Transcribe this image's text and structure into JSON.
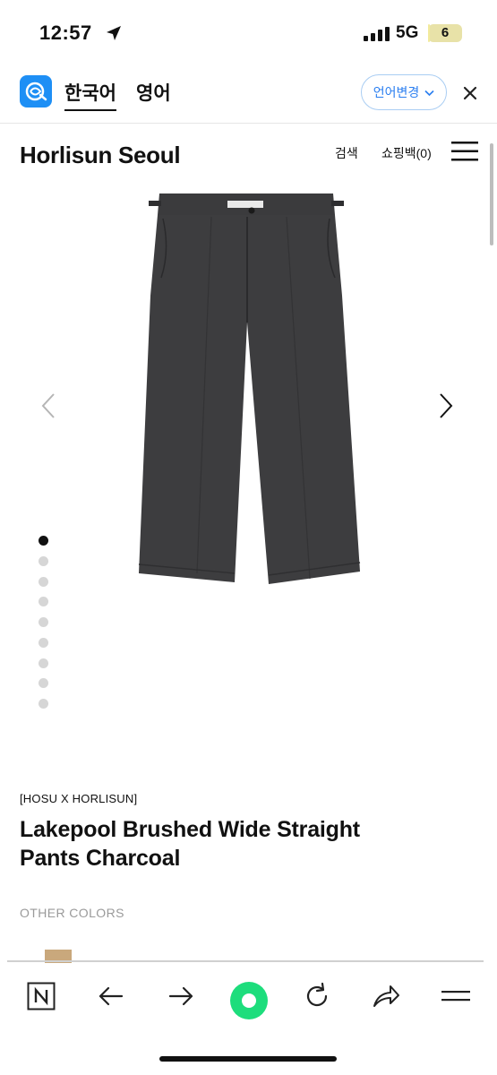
{
  "status": {
    "time": "12:57",
    "network": "5G",
    "battery": "6",
    "battery_level": 0.06
  },
  "translate": {
    "lang_current": "한국어",
    "lang_target": "영어",
    "change_button": "언어변경"
  },
  "site": {
    "brand": "Horlisun Seoul",
    "search_label": "검색",
    "cart_label": "쇼핑백(0)"
  },
  "gallery": {
    "total_images": 9,
    "active_index": 0
  },
  "product": {
    "collab": "[HOSU X HORLISUN]",
    "title": "Lakepool Brushed Wide Straight Pants Charcoal",
    "other_colors_label": "OTHER COLORS"
  },
  "colors": {
    "accent": "#1e8ff5",
    "record_button": "#1ddd7c",
    "garment": "#3d3d3f"
  },
  "toolbar": {
    "icons": [
      "naver-home-icon",
      "back-arrow-icon",
      "forward-arrow-icon",
      "record-icon",
      "reload-icon",
      "share-icon",
      "menu-icon"
    ]
  }
}
